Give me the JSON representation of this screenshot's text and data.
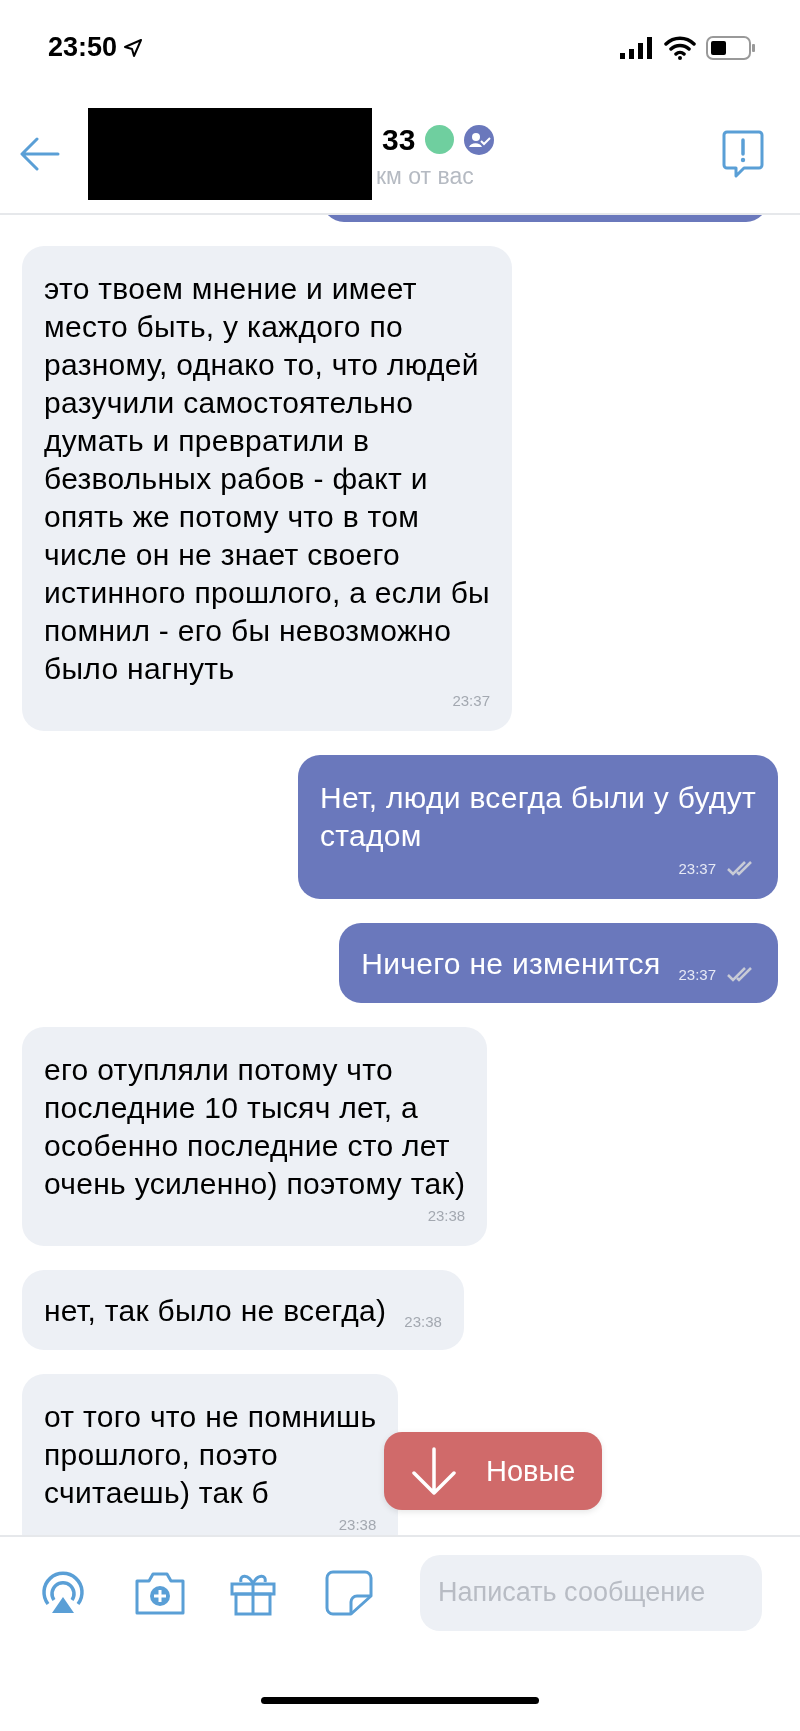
{
  "status_bar": {
    "time": "23:50"
  },
  "header": {
    "name": "33",
    "online": true,
    "verified": true,
    "subtitle": "км от вас"
  },
  "messages": [
    {
      "outgoing": true,
      "kind": "peek"
    },
    {
      "outgoing": false,
      "kind": "stacked",
      "text": "это твоем мнение и имеет\nместо быть, у каждого по\nразному, однако то, что людей\nразучили самостоятельно\nдумать и превратили в\nбезвольных рабов - факт и\nопять же потому что в том\nчисле он не знает своего\nистинного прошлого, а если бы\nпомнил - его бы невозможно\nбыло нагнуть",
      "time": "23:37"
    },
    {
      "outgoing": true,
      "kind": "stacked",
      "text": "Нет, люди всегда были у будут\nстадом",
      "time": "23:37",
      "read": true
    },
    {
      "outgoing": true,
      "kind": "inline",
      "text": "Ничего не изменится",
      "time": "23:37",
      "read": true
    },
    {
      "outgoing": false,
      "kind": "stacked",
      "text": "его отупляли потому что\nпоследние 10 тысяч лет, а\nособенно последние сто лет\nочень усиленно) поэтому так)",
      "time": "23:38"
    },
    {
      "outgoing": false,
      "kind": "inline",
      "text": "нет, так было не всегда)",
      "time": "23:38"
    },
    {
      "outgoing": false,
      "kind": "stacked",
      "text": "от того что не помнишь\nпрошлого, поэто\nсчитаешь) так б",
      "time": "23:38"
    }
  ],
  "new_messages_button": {
    "label": "Новые"
  },
  "composer": {
    "placeholder": "Написать сообщение"
  }
}
